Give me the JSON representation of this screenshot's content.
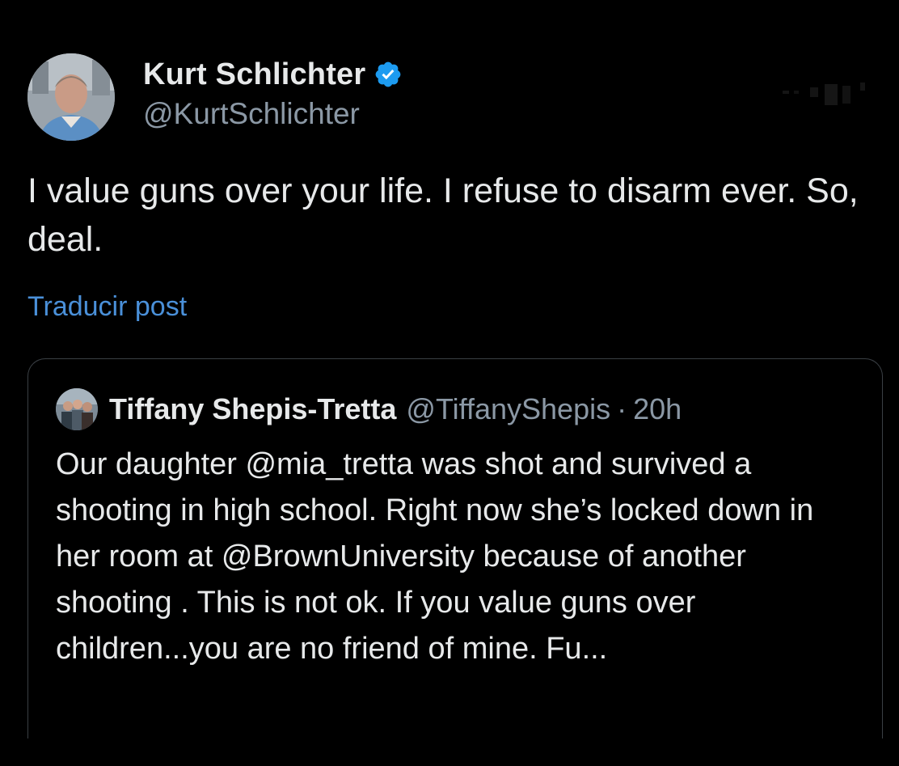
{
  "post": {
    "author": {
      "display_name": "Kurt Schlichter",
      "handle": "@KurtSchlichter",
      "verified": true,
      "avatar_icon": "profile-photo"
    },
    "text": "I value guns over your life. I refuse to disarm ever. So, deal.",
    "translate_label": "Traducir post",
    "more_icon": "more-options-icon"
  },
  "quoted_post": {
    "author": {
      "display_name": "Tiffany Shepis-Tretta",
      "handle": "@TiffanyShepis",
      "separator": "·",
      "time": "20h",
      "avatar_icon": "group-photo"
    },
    "text": "Our daughter @mia_tretta was shot and survived a shooting in high school. Right now she’s locked down in her room at @BrownUniversity because of another shooting . This is not ok. If you value guns over children...you are no friend of mine. Fu..."
  },
  "colors": {
    "background": "#000000",
    "primary_text": "#e7e9ea",
    "secondary_text": "#8b98a5",
    "link": "#4a90d9",
    "verified_badge": "#1d9bf0",
    "border": "#3a3f44"
  }
}
